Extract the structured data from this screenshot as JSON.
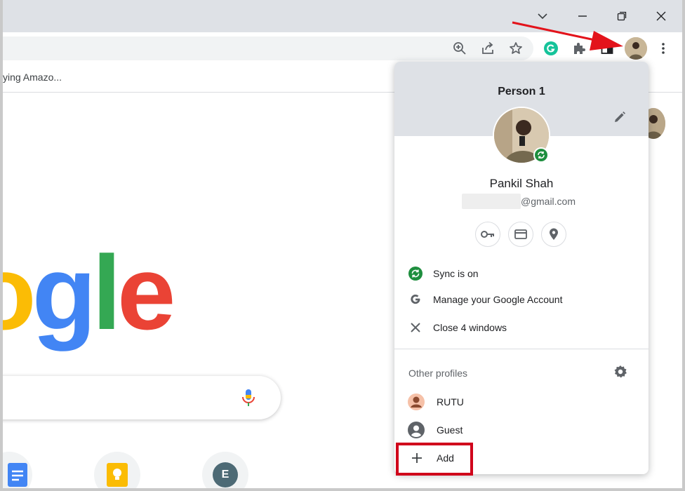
{
  "browser": {
    "bookmark_partial": "ying Amazo...",
    "window_buttons": [
      "tab-search-icon",
      "minimize-icon",
      "restore-icon",
      "close-icon"
    ],
    "toolbar_icons": [
      "zoom-icon",
      "share-icon",
      "star-icon",
      "grammarly-icon",
      "extensions-icon",
      "sidebar-icon",
      "profile-avatar",
      "menu-icon"
    ],
    "accent_color": "#1a73e8"
  },
  "page": {
    "logo_partial": "ogle",
    "logo_colors": {
      "o": "#fbbc05",
      "g": "#4285f4",
      "l": "#34a853",
      "e": "#ea4335"
    },
    "shortcut_letter": "E"
  },
  "profile_panel": {
    "title": "Person 1",
    "name": "Pankil Shah",
    "email_suffix": "@gmail.com",
    "quick_buttons": [
      "password-key-icon",
      "payment-card-icon",
      "location-pin-icon"
    ],
    "menu": {
      "sync": "Sync is on",
      "manage": "Manage your Google Account",
      "close_windows": "Close 4 windows"
    },
    "other_profiles_label": "Other profiles",
    "profiles": {
      "rutu": "RUTU",
      "guest": "Guest",
      "add": "Add"
    }
  },
  "annotations": {
    "highlight_color": "#d0021b"
  }
}
